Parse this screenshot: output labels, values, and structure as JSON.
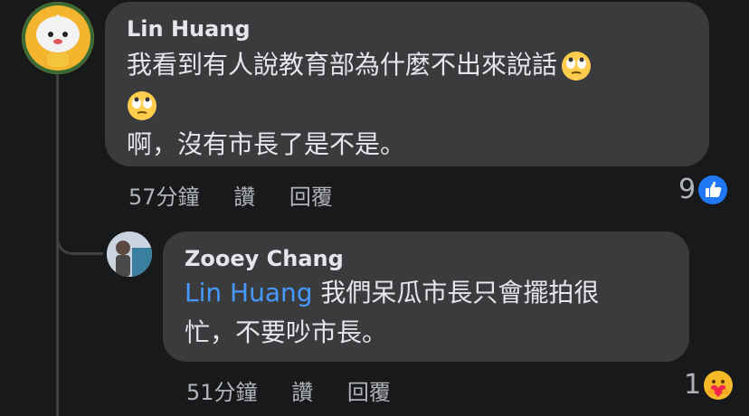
{
  "comments": [
    {
      "author": "Lin Huang",
      "lines": [
        "我看到有人說教育部為什麼不出來說話",
        "",
        "啊，沒有市長了是不是。"
      ],
      "time": "57分鐘",
      "like_label": "讚",
      "reply_label": "回覆",
      "reaction_count": "9",
      "reaction_icon": "like-icon",
      "emoji_icon": "eye-roll-emoji-icon"
    },
    {
      "author": "Zooey Chang",
      "mention": "Lin Huang",
      "line1": " 我們呆瓜市長只會擺拍很",
      "line2": "忙，不要吵市長。",
      "time": "51分鐘",
      "like_label": "讚",
      "reply_label": "回覆",
      "reaction_count": "1",
      "reaction_icon": "care-emoji-icon"
    }
  ],
  "colors": {
    "background": "#18191a",
    "bubble": "#3a3b3c",
    "mention": "#4599ff",
    "like_blue": "#2078f4"
  }
}
